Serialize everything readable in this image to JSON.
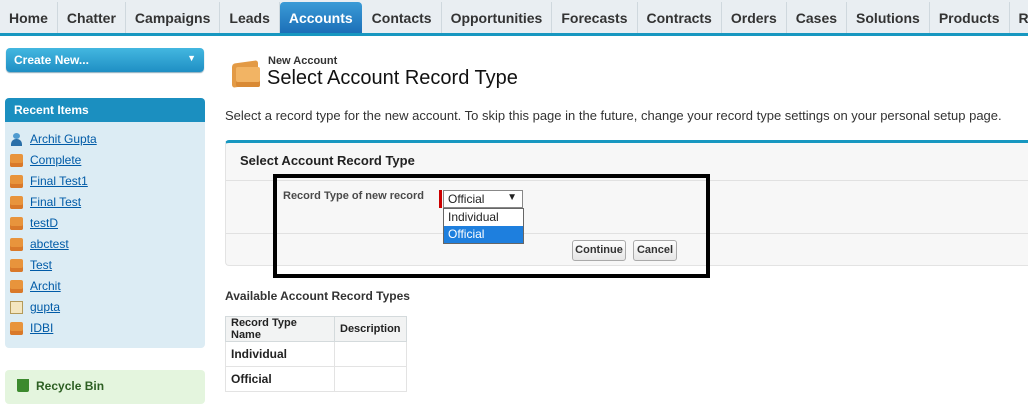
{
  "tabs": [
    {
      "label": "Home",
      "active": false
    },
    {
      "label": "Chatter",
      "active": false
    },
    {
      "label": "Campaigns",
      "active": false
    },
    {
      "label": "Leads",
      "active": false
    },
    {
      "label": "Accounts",
      "active": true
    },
    {
      "label": "Contacts",
      "active": false
    },
    {
      "label": "Opportunities",
      "active": false
    },
    {
      "label": "Forecasts",
      "active": false
    },
    {
      "label": "Contracts",
      "active": false
    },
    {
      "label": "Orders",
      "active": false
    },
    {
      "label": "Cases",
      "active": false
    },
    {
      "label": "Solutions",
      "active": false
    },
    {
      "label": "Products",
      "active": false
    },
    {
      "label": "Reports",
      "active": false
    }
  ],
  "sidebar": {
    "create_new_label": "Create New...",
    "recent_header": "Recent Items",
    "recent_items": [
      {
        "label": "Archit Gupta",
        "icon": "person-icon"
      },
      {
        "label": "Complete",
        "icon": "account-folder-icon"
      },
      {
        "label": "Final Test1",
        "icon": "account-folder-icon"
      },
      {
        "label": "Final Test",
        "icon": "account-folder-icon"
      },
      {
        "label": "testD",
        "icon": "account-folder-icon"
      },
      {
        "label": "abctest",
        "icon": "account-folder-icon"
      },
      {
        "label": "Test",
        "icon": "account-folder-icon"
      },
      {
        "label": "Archit",
        "icon": "account-folder-icon"
      },
      {
        "label": "gupta",
        "icon": "document-icon"
      },
      {
        "label": "IDBI",
        "icon": "account-folder-icon"
      }
    ],
    "recycle_bin_label": "Recycle Bin"
  },
  "main": {
    "subtitle": "New Account",
    "title": "Select Account Record Type",
    "description": "Select a record type for the new account. To skip this page in the future, change your record type settings on your personal setup page.",
    "section_title": "Select Account Record Type",
    "field_label": "Record Type of new record",
    "select_value": "Official",
    "options": [
      "Individual",
      "Official"
    ],
    "selected_option": "Official",
    "continue_label": "Continue",
    "cancel_label": "Cancel",
    "available_title": "Available Account Record Types",
    "table_headers": [
      "Record Type Name",
      "Description"
    ],
    "table_rows": [
      {
        "name": "Individual",
        "description": ""
      },
      {
        "name": "Official",
        "description": ""
      }
    ]
  },
  "colors": {
    "accent": "#1797c0",
    "active_tab": "#2a84c8",
    "highlight_border": "#000000",
    "selected_option": "#1e7fde"
  }
}
